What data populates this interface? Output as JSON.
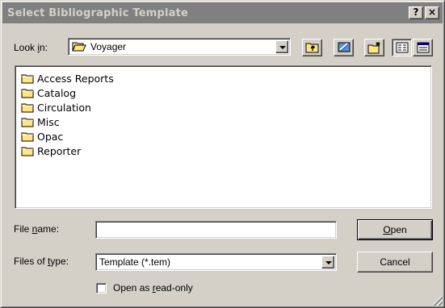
{
  "window": {
    "title": "Select Bibliographic Template",
    "help_label": "?",
    "close_label": "×"
  },
  "lookin": {
    "label_pre": "Look ",
    "label_key": "i",
    "label_post": "n:",
    "value": "Voyager"
  },
  "files": [
    {
      "name": "Access Reports",
      "icon": "folder-icon"
    },
    {
      "name": "Catalog",
      "icon": "folder-icon"
    },
    {
      "name": "Circulation",
      "icon": "folder-icon"
    },
    {
      "name": "Misc",
      "icon": "folder-icon"
    },
    {
      "name": "Opac",
      "icon": "folder-icon"
    },
    {
      "name": "Reporter",
      "icon": "folder-icon"
    }
  ],
  "filename": {
    "label_pre": "File ",
    "label_key": "n",
    "label_post": "ame:",
    "value": ""
  },
  "filetype": {
    "label_pre": "Files of ",
    "label_key": "t",
    "label_post": "ype:",
    "value": "Template (*.tem)"
  },
  "buttons": {
    "open_key": "O",
    "open_rest": "pen",
    "cancel": "Cancel"
  },
  "readonly": {
    "label_pre": "Open as ",
    "label_key": "r",
    "label_post": "ead-only",
    "checked": false
  },
  "colors": {
    "titlebar_inactive": "#808080",
    "face": "#d4d0c8",
    "folder_yellow": "#ffe680"
  }
}
